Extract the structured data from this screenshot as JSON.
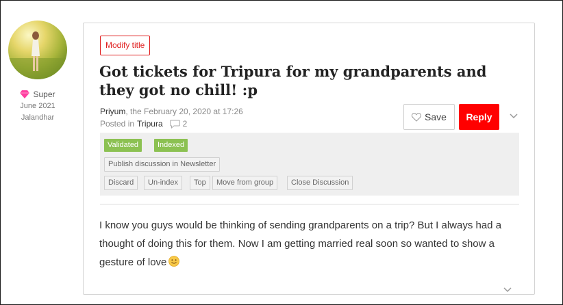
{
  "author": {
    "rank": "Super",
    "joined": "June 2021",
    "location": "Jalandhar"
  },
  "discussion": {
    "modify_title_label": "Modify title",
    "title": "Got tickets for Tripura for my grandparents and they got no chill! :p",
    "author_name": "Priyum",
    "date_text": ", the February 20, 2020 at 17:26",
    "posted_in_label": "Posted in",
    "group": "Tripura",
    "comment_count": "2",
    "save_label": "Save",
    "reply_label": "Reply",
    "body": "I know you guys would be thinking of sending grandparents on a trip? But I always had a thought of doing this for them. Now I am getting married real soon so wanted to show a gesture of love"
  },
  "moderation": {
    "badges": [
      "Validated",
      "Indexed"
    ],
    "newsletter_label": "Publish discussion in Newsletter",
    "actions": [
      "Discard",
      "Un-index",
      "Top",
      "Move from group",
      "Close Discussion"
    ]
  },
  "colors": {
    "accent": "#ff0000",
    "badge_green": "#8cc152"
  }
}
